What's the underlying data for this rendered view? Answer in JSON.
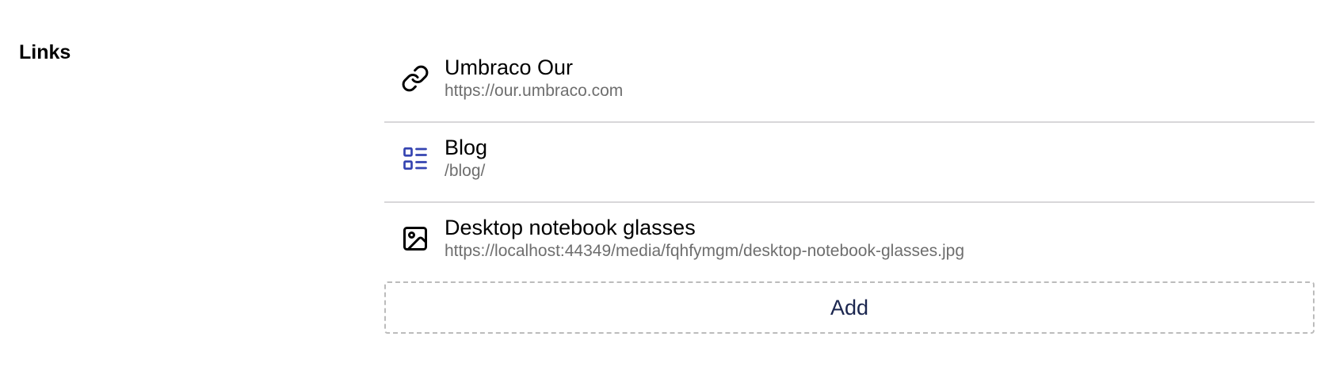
{
  "property": {
    "label": "Links"
  },
  "links": [
    {
      "name": "Umbraco Our",
      "url": "https://our.umbraco.com",
      "icon": "link-icon",
      "icon_color": "#000000"
    },
    {
      "name": "Blog",
      "url": "/blog/",
      "icon": "list-document-icon",
      "icon_color": "#3544b1"
    },
    {
      "name": "Desktop notebook glasses",
      "url": "https://localhost:44349/media/fqhfymgm/desktop-notebook-glasses.jpg",
      "icon": "image-icon",
      "icon_color": "#000000"
    }
  ],
  "actions": {
    "add_label": "Add"
  },
  "colors": {
    "text": "#000000",
    "secondary_text": "#6e6e6e",
    "divider": "#d8d7d9",
    "accent": "#3544b1",
    "button_text": "#1b264f"
  }
}
